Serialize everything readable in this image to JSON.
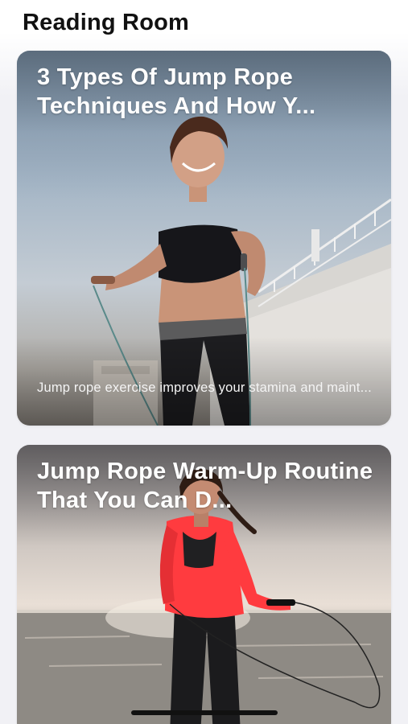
{
  "header": {
    "title": "Reading Room"
  },
  "articles": [
    {
      "title": "3 Types Of Jump Rope Techniques And How Y...",
      "excerpt": "Jump rope exercise improves your stamina and maint...",
      "image_subject": "woman in black sports bra holding jump rope by a seaside pier"
    },
    {
      "title": "Jump Rope Warm-Up Routine That You Can D...",
      "image_subject": "woman in red jacket skipping rope on a beach at sunset"
    }
  ]
}
